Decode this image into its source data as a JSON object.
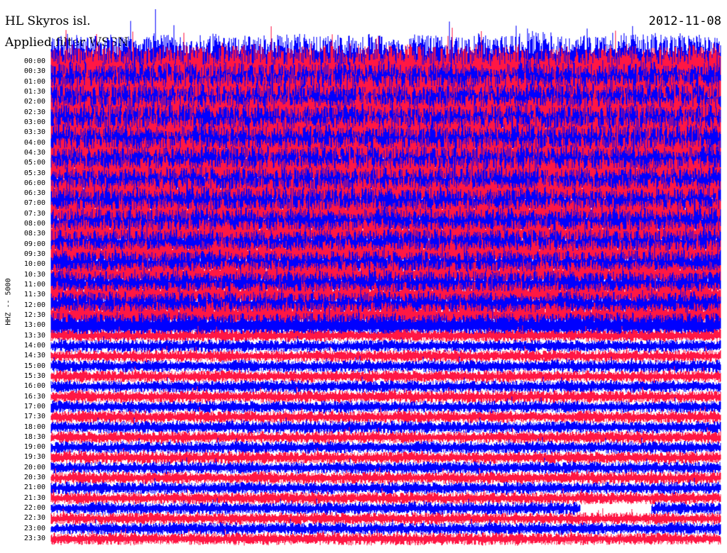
{
  "header": {
    "station": "HL Skyros isl.",
    "filter": "Applied filter WSSN",
    "date": "2012-11-08"
  },
  "channel_label": "HHZ -- 5000",
  "time_labels": [
    "00:00",
    "00:30",
    "01:00",
    "01:30",
    "02:00",
    "02:30",
    "03:00",
    "03:30",
    "04:00",
    "04:30",
    "05:00",
    "05:30",
    "06:00",
    "06:30",
    "07:00",
    "07:30",
    "08:00",
    "08:30",
    "09:00",
    "09:30",
    "10:00",
    "10:30",
    "11:00",
    "11:30",
    "12:00",
    "12:30",
    "13:00",
    "13:30",
    "14:00",
    "14:30",
    "15:00",
    "15:30",
    "16:00",
    "16:30",
    "17:00",
    "17:30",
    "18:00",
    "18:30",
    "19:00",
    "19:30",
    "20:00",
    "20:30",
    "21:00",
    "21:30",
    "22:00",
    "22:30",
    "23:00",
    "23:30"
  ],
  "colors": {
    "trace_a": "#0000ff",
    "trace_b": "#ff1744"
  },
  "trace_noise": {
    "high_noise_until_row": 27,
    "data_gap_row": 44
  }
}
